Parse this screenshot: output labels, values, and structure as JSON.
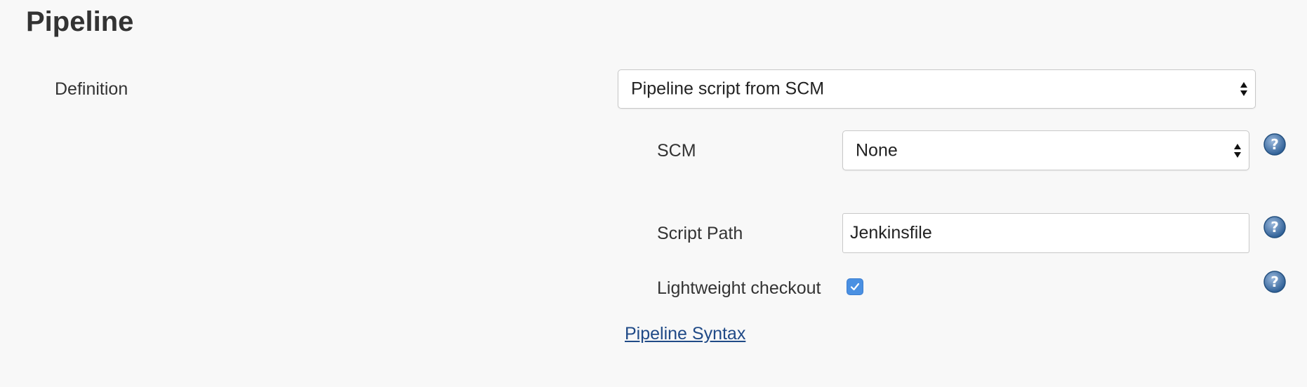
{
  "section": {
    "title": "Pipeline"
  },
  "definition": {
    "label": "Definition",
    "selected": "Pipeline script from SCM"
  },
  "scm": {
    "label": "SCM",
    "selected": "None"
  },
  "script_path": {
    "label": "Script Path",
    "value": "Jenkinsfile"
  },
  "lightweight_checkout": {
    "label": "Lightweight checkout",
    "checked": true
  },
  "links": {
    "pipeline_syntax": "Pipeline Syntax"
  },
  "icons": {
    "help": "help-icon",
    "select_arrows": "chevron-up-down-icon",
    "check": "checkmark-icon"
  },
  "colors": {
    "background": "#f8f8f8",
    "link": "#204a87",
    "checkbox": "#4a90e2",
    "help_icon": "#2e5f96"
  }
}
